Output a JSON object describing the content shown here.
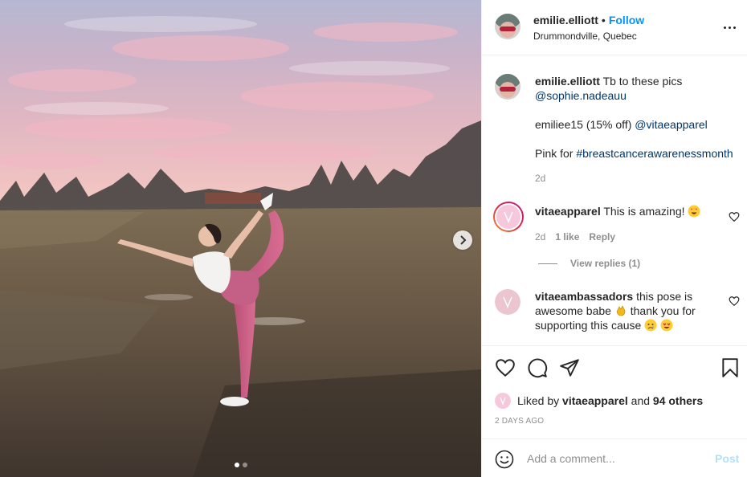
{
  "post": {
    "username": "emilie.elliott",
    "separator": "•",
    "follow_label": "Follow",
    "location": "Drummondville, Quebec"
  },
  "caption": {
    "username": "emilie.elliott",
    "text_1": "Tb to these pics",
    "mention_1": "@sophie.nadeauu",
    "text_2": "emiliee15 (15% off)",
    "mention_2": "@vitaeapparel",
    "text_3": "Pink for",
    "hashtag": "#breastcancerawarenessmonth",
    "age": "2d"
  },
  "comments": [
    {
      "username": "vitaeapparel",
      "text": "This is amazing!",
      "emoji": "star-struck",
      "age": "2d",
      "likes": "1 like",
      "reply_label": "Reply",
      "view_replies": "View replies (1)"
    },
    {
      "username": "vitaeambassadors",
      "text_1": "this pose is",
      "text_2": "awesome babe",
      "emoji_1": "clapping-hands",
      "text_3": "thank you for",
      "text_4": "supporting this cause",
      "emoji_2": "crying-face",
      "emoji_3": "heart-eyes"
    }
  ],
  "likes": {
    "prefix": "Liked by",
    "user": "vitaeapparel",
    "conj": "and",
    "others": "94 others"
  },
  "date": "2 DAYS AGO",
  "add_comment": {
    "placeholder": "Add a comment...",
    "post_label": "Post"
  },
  "icons": {
    "like": "heart-icon",
    "comment": "comment-icon",
    "share": "share-icon",
    "save": "bookmark-icon",
    "more": "more-options-icon",
    "emoji": "emoji-icon",
    "next": "chevron-right-icon"
  },
  "colors": {
    "accent": "#0095f6",
    "link": "#00376b",
    "muted": "#8e8e8e",
    "post_disabled": "#b2dffc",
    "brand_pink": "#f6c8dc"
  },
  "carousel": {
    "slides": 2,
    "current": 1
  }
}
